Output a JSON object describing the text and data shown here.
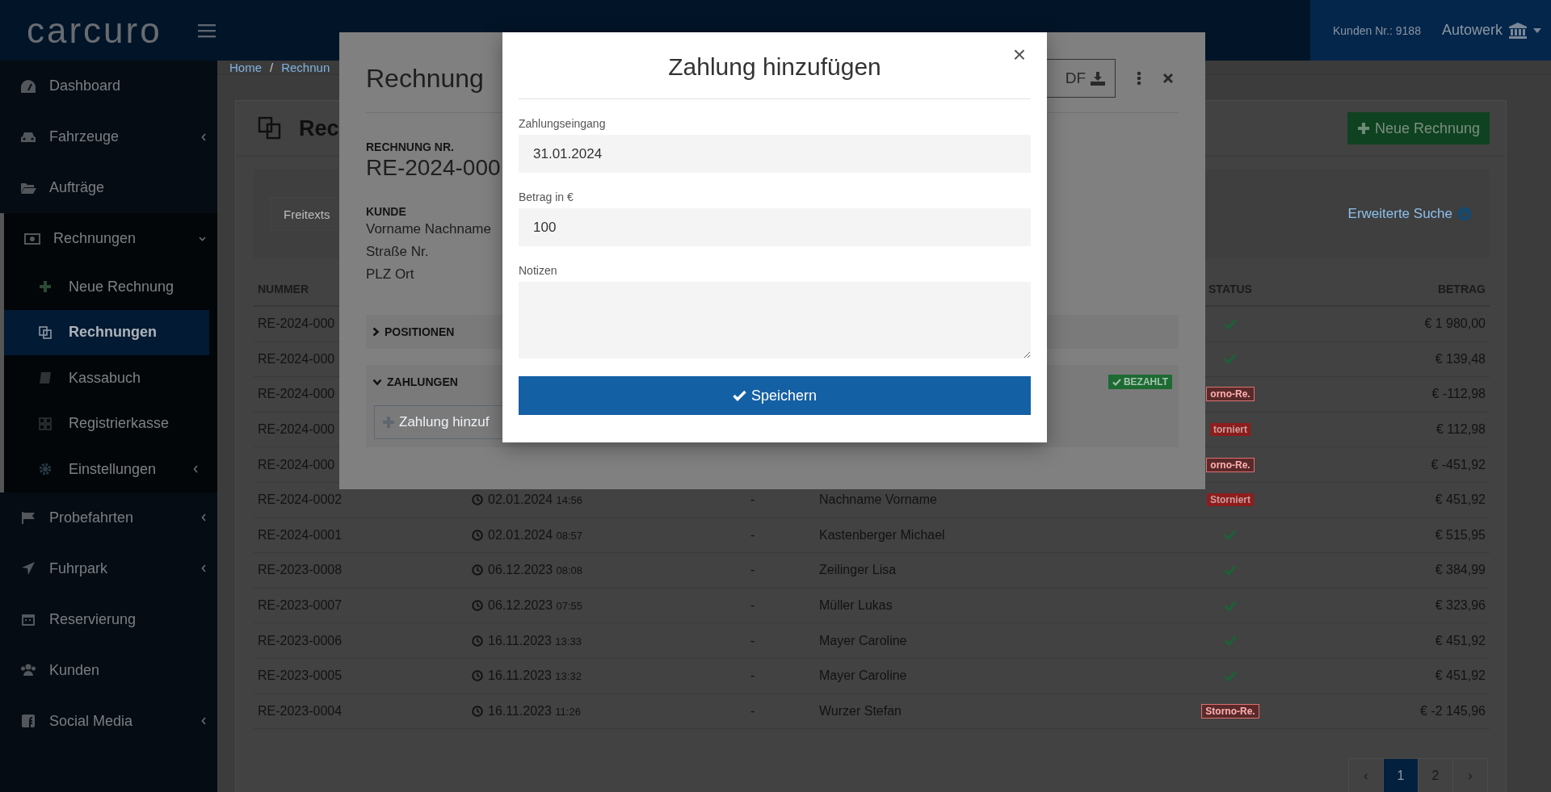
{
  "topbar": {
    "logo": "carcuro",
    "customer_no": "Kunden Nr.: 9188",
    "company": "Autowerk"
  },
  "sidebar": {
    "items": [
      {
        "label": "Dashboard"
      },
      {
        "label": "Fahrzeuge",
        "expanded": false
      },
      {
        "label": "Aufträge"
      },
      {
        "label": "Rechnungen",
        "expanded": true,
        "children": [
          {
            "label": "Neue Rechnung",
            "selected": false
          },
          {
            "label": "Rechnungen",
            "selected": true
          },
          {
            "label": "Kassabuch",
            "selected": false
          },
          {
            "label": "Registrierkasse",
            "selected": false
          },
          {
            "label": "Einstellungen",
            "selected": false,
            "expanded": false
          }
        ]
      },
      {
        "label": "Probefahrten",
        "expanded": false
      },
      {
        "label": "Fuhrpark",
        "expanded": false
      },
      {
        "label": "Reservierung"
      },
      {
        "label": "Kunden"
      },
      {
        "label": "Social Media",
        "expanded": false
      }
    ]
  },
  "breadcrumb": {
    "items": [
      "Home",
      "Rechnun"
    ],
    "separator": "/"
  },
  "page": {
    "title": "Rec",
    "new_button": "Neue Rechnung",
    "search_placeholder": "Freitexts",
    "advanced_search": "Erweiterte Suche"
  },
  "table": {
    "columns": [
      "NUMMER",
      "STATUS",
      "BETRAG"
    ],
    "rows": [
      {
        "number": "RE-2024-000",
        "status": {
          "kind": "paid"
        },
        "amount": "€ 1 980,00"
      },
      {
        "number": "RE-2024-000",
        "status": {
          "kind": "paid"
        },
        "amount": "€ 139,48"
      },
      {
        "number": "RE-2024-000",
        "status": {
          "kind": "reversal",
          "text": "orno-Re."
        },
        "amount": "€ -112,98"
      },
      {
        "number": "RE-2024-000",
        "status": {
          "kind": "cancelled",
          "text": "torniert"
        },
        "amount": "€ 112,98"
      },
      {
        "number": "RE-2024-000",
        "status": {
          "kind": "reversal",
          "text": "orno-Re."
        },
        "amount": "€ -451,92"
      },
      {
        "number": "RE-2024-0002",
        "date": "02.01.2024",
        "time": "14:56",
        "column_3": "-",
        "customer": "Nachname Vorname",
        "status": {
          "kind": "cancelled",
          "text": "Storniert"
        },
        "amount": "€ 451,92"
      },
      {
        "number": "RE-2024-0001",
        "date": "02.01.2024",
        "time": "08:57",
        "column_3": "-",
        "customer": "Kastenberger Michael",
        "status": {
          "kind": "paid"
        },
        "amount": "€ 515,95"
      },
      {
        "number": "RE-2023-0008",
        "date": "06.12.2023",
        "time": "08:08",
        "column_3": "-",
        "customer": "Zeilinger Lisa",
        "status": {
          "kind": "paid"
        },
        "amount": "€ 384,99"
      },
      {
        "number": "RE-2023-0007",
        "date": "06.12.2023",
        "time": "07:55",
        "column_3": "-",
        "customer": "Müller Lukas",
        "status": {
          "kind": "paid"
        },
        "amount": "€ 323,96"
      },
      {
        "number": "RE-2023-0006",
        "date": "16.11.2023",
        "time": "13:33",
        "column_3": "-",
        "customer": "Mayer Caroline",
        "status": {
          "kind": "paid"
        },
        "amount": "€ 451,92"
      },
      {
        "number": "RE-2023-0005",
        "date": "16.11.2023",
        "time": "13:32",
        "column_3": "-",
        "customer": "Mayer Caroline",
        "status": {
          "kind": "paid"
        },
        "amount": "€ 451,92"
      },
      {
        "number": "RE-2023-0004",
        "date": "16.11.2023",
        "time": "11:26",
        "column_3": "-",
        "customer": "Wurzer Stefan",
        "status": {
          "kind": "reversal",
          "text": "Storno-Re."
        },
        "amount": "€ -2 145,96"
      }
    ]
  },
  "pagination": {
    "prev": "‹",
    "pages": [
      {
        "label": "1",
        "selected": true
      },
      {
        "label": "2",
        "selected": false
      }
    ],
    "next": "›"
  },
  "invoice_panel": {
    "title": "Rechnung",
    "pdf_button": "DF",
    "number_label": "RECHNUNG NR.",
    "number": "RE-2024-000",
    "customer_label": "KUNDE",
    "customer_lines": [
      "Vorname Nachname",
      "Straße Nr.",
      "PLZ Ort"
    ],
    "sections": [
      {
        "title": "POSITIONEN",
        "expanded": false
      },
      {
        "title": "ZAHLUNGEN",
        "expanded": true,
        "badge": "BEZAHLT",
        "add_button": "Zahlung hinzuf"
      }
    ]
  },
  "payment_dialog": {
    "title": "Zahlung hinzufügen",
    "close": "×",
    "fields": [
      {
        "kind": "input",
        "label": "Zahlungseingang",
        "value": "31.01.2024"
      },
      {
        "kind": "input",
        "label": "Betrag in €",
        "value": "100"
      },
      {
        "kind": "textarea",
        "label": "Notizen"
      }
    ],
    "submit": "Speichern"
  }
}
